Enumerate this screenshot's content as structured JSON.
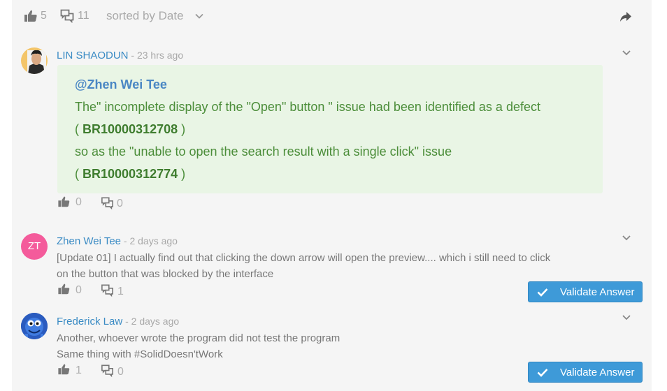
{
  "topbar": {
    "likes": "5",
    "comments": "11",
    "sort_label": "sorted by Date"
  },
  "comments": [
    {
      "author": "LIN SHAODUN",
      "time": " - 23 hrs ago",
      "quote": {
        "mention": "@Zhen Wei Tee",
        "line1": "The\" incomplete display of the \"Open\" button \" issue had been identified as a defect",
        "ref1_open": "( ",
        "ref1": "BR10000312708",
        "ref1_close": " )",
        "line3": "so as the \"unable to open the search result with a single click\" issue",
        "ref2_open": "( ",
        "ref2": "BR10000312774",
        "ref2_close": " )"
      },
      "likes": "0",
      "replies": "0"
    },
    {
      "author": "Zhen Wei Tee",
      "avatar_initials": "ZT",
      "time": " - 2 days ago",
      "line1": "[Update 01] I actually find out that clicking the down arrow will open the preview.... which i still need to click",
      "line2": "on the button that was blocked by the interface",
      "likes": "0",
      "replies": "1",
      "validate_label": "Validate Answer"
    },
    {
      "author": "Frederick Law",
      "time": " - 2 days ago",
      "line1": "Another, whoever wrote the program did not test the program",
      "line2": "Same thing with #SolidDoesn'tWork",
      "likes": "1",
      "replies": "0",
      "validate_label": "Validate Answer"
    }
  ],
  "colors": {
    "link": "#3a8bc4",
    "quote_bg": "#e9f5e5",
    "quote_text": "#4b8d39",
    "button": "#3e9ad8",
    "avatar_zt": "#f45b9b"
  }
}
